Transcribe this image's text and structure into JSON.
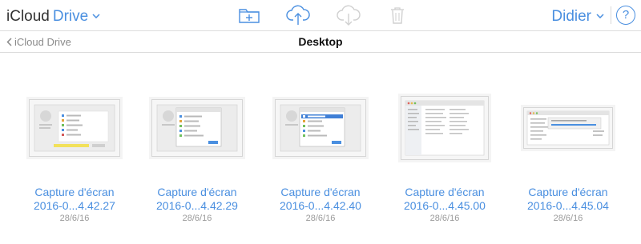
{
  "app": {
    "brand": "iCloud",
    "section": "Drive",
    "user": "Didier",
    "help": "?"
  },
  "toolbar": {
    "icons": [
      "new-folder-icon",
      "upload-icon",
      "download-icon",
      "trash-icon"
    ]
  },
  "nav": {
    "back_label": "iCloud Drive",
    "title": "Desktop"
  },
  "files": [
    {
      "name_line1": "Capture d'écran",
      "name_line2": "2016-0...4.42.27",
      "date": "28/6/16"
    },
    {
      "name_line1": "Capture d'écran",
      "name_line2": "2016-0...4.42.29",
      "date": "28/6/16"
    },
    {
      "name_line1": "Capture d'écran",
      "name_line2": "2016-0...4.42.40",
      "date": "28/6/16"
    },
    {
      "name_line1": "Capture d'écran",
      "name_line2": "2016-0...4.45.00",
      "date": "28/6/16"
    },
    {
      "name_line1": "Capture d'écran",
      "name_line2": "2016-0...4.45.04",
      "date": "28/6/16"
    }
  ],
  "colors": {
    "accent": "#4a8fe0",
    "disabled_icon": "#d0d0d0"
  }
}
